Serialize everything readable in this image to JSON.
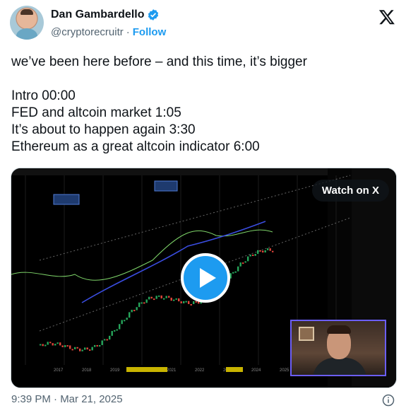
{
  "author": {
    "display_name": "Dan Gambardello",
    "handle": "@cryptorecruitr",
    "separator": "·",
    "follow_label": "Follow"
  },
  "tweet": {
    "text": "we’ve been here before – and this time, it’s bigger\n\nIntro 00:00\nFED and altcoin market 1:05\nIt’s about to happen again 3:30\nEthereum as a great altcoin indicator 6:00",
    "timestamp": "9:39 PM · Mar 21, 2025"
  },
  "media": {
    "watch_label": "Watch on X",
    "axis_years": [
      "2017",
      "2018",
      "2019",
      "2020",
      "2021",
      "2022",
      "2023",
      "2024",
      "2025",
      "2026"
    ]
  },
  "colors": {
    "accent": "#1d9bf0",
    "up_candle": "#26a65b",
    "down_candle": "#e0453a"
  },
  "icons": [
    "verified-badge-icon",
    "x-logo-icon",
    "play-icon",
    "info-icon"
  ]
}
